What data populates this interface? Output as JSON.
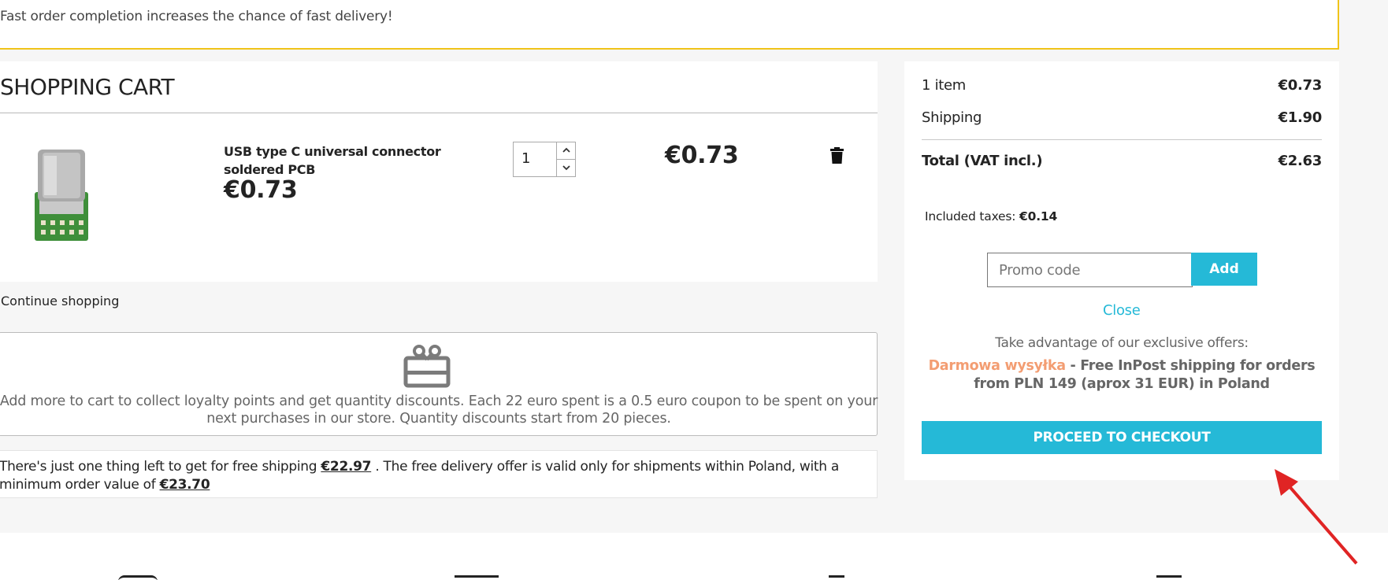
{
  "notice": {
    "text": "Fast order completion increases the chance of fast delivery!"
  },
  "cart": {
    "title": "SHOPPING CART",
    "item": {
      "name": "USB type C universal connector soldered PCB",
      "unit_price": "€0.73",
      "quantity": "1",
      "line_total": "€0.73",
      "image_icon": "usb-c-connector-product-image"
    },
    "continue_label": "Continue shopping"
  },
  "loyalty": {
    "icon": "gift-card-icon",
    "text": "Add more to cart to collect loyalty points and get quantity discounts. Each 22 euro spent is a 0.5 euro coupon to be spent on your next purchases in our store. Quantity discounts start from 20 pieces."
  },
  "free_shipping": {
    "text_before": "There's just one thing left to get for free shipping",
    "remaining": "€22.97",
    "text_middle": ". The free delivery offer is valid only for shipments within Poland, with a minimum order value of",
    "minimum": "€23.70"
  },
  "summary": {
    "items_label": "1 item",
    "items_amount": "€0.73",
    "shipping_label": "Shipping",
    "shipping_amount": "€1.90",
    "total_label": "Total (VAT incl.)",
    "total_amount": "€2.63",
    "taxes_label": "Included taxes:",
    "taxes_amount": "€0.14",
    "promo_placeholder": "Promo code",
    "add_label": "Add",
    "close_label": "Close",
    "offers_title": "Take advantage of our exclusive offers:",
    "offer_name": "Darmowa wysyłka",
    "offer_desc": " - Free InPost shipping for orders from PLN 149 (aprox 31 EUR) in Poland",
    "checkout_label": "PROCEED TO CHECKOUT"
  },
  "colors": {
    "accent": "#25b9d7",
    "notice_border": "#f0c419",
    "offer_name": "#f39d72",
    "annotation_arrow": "#e02424"
  }
}
